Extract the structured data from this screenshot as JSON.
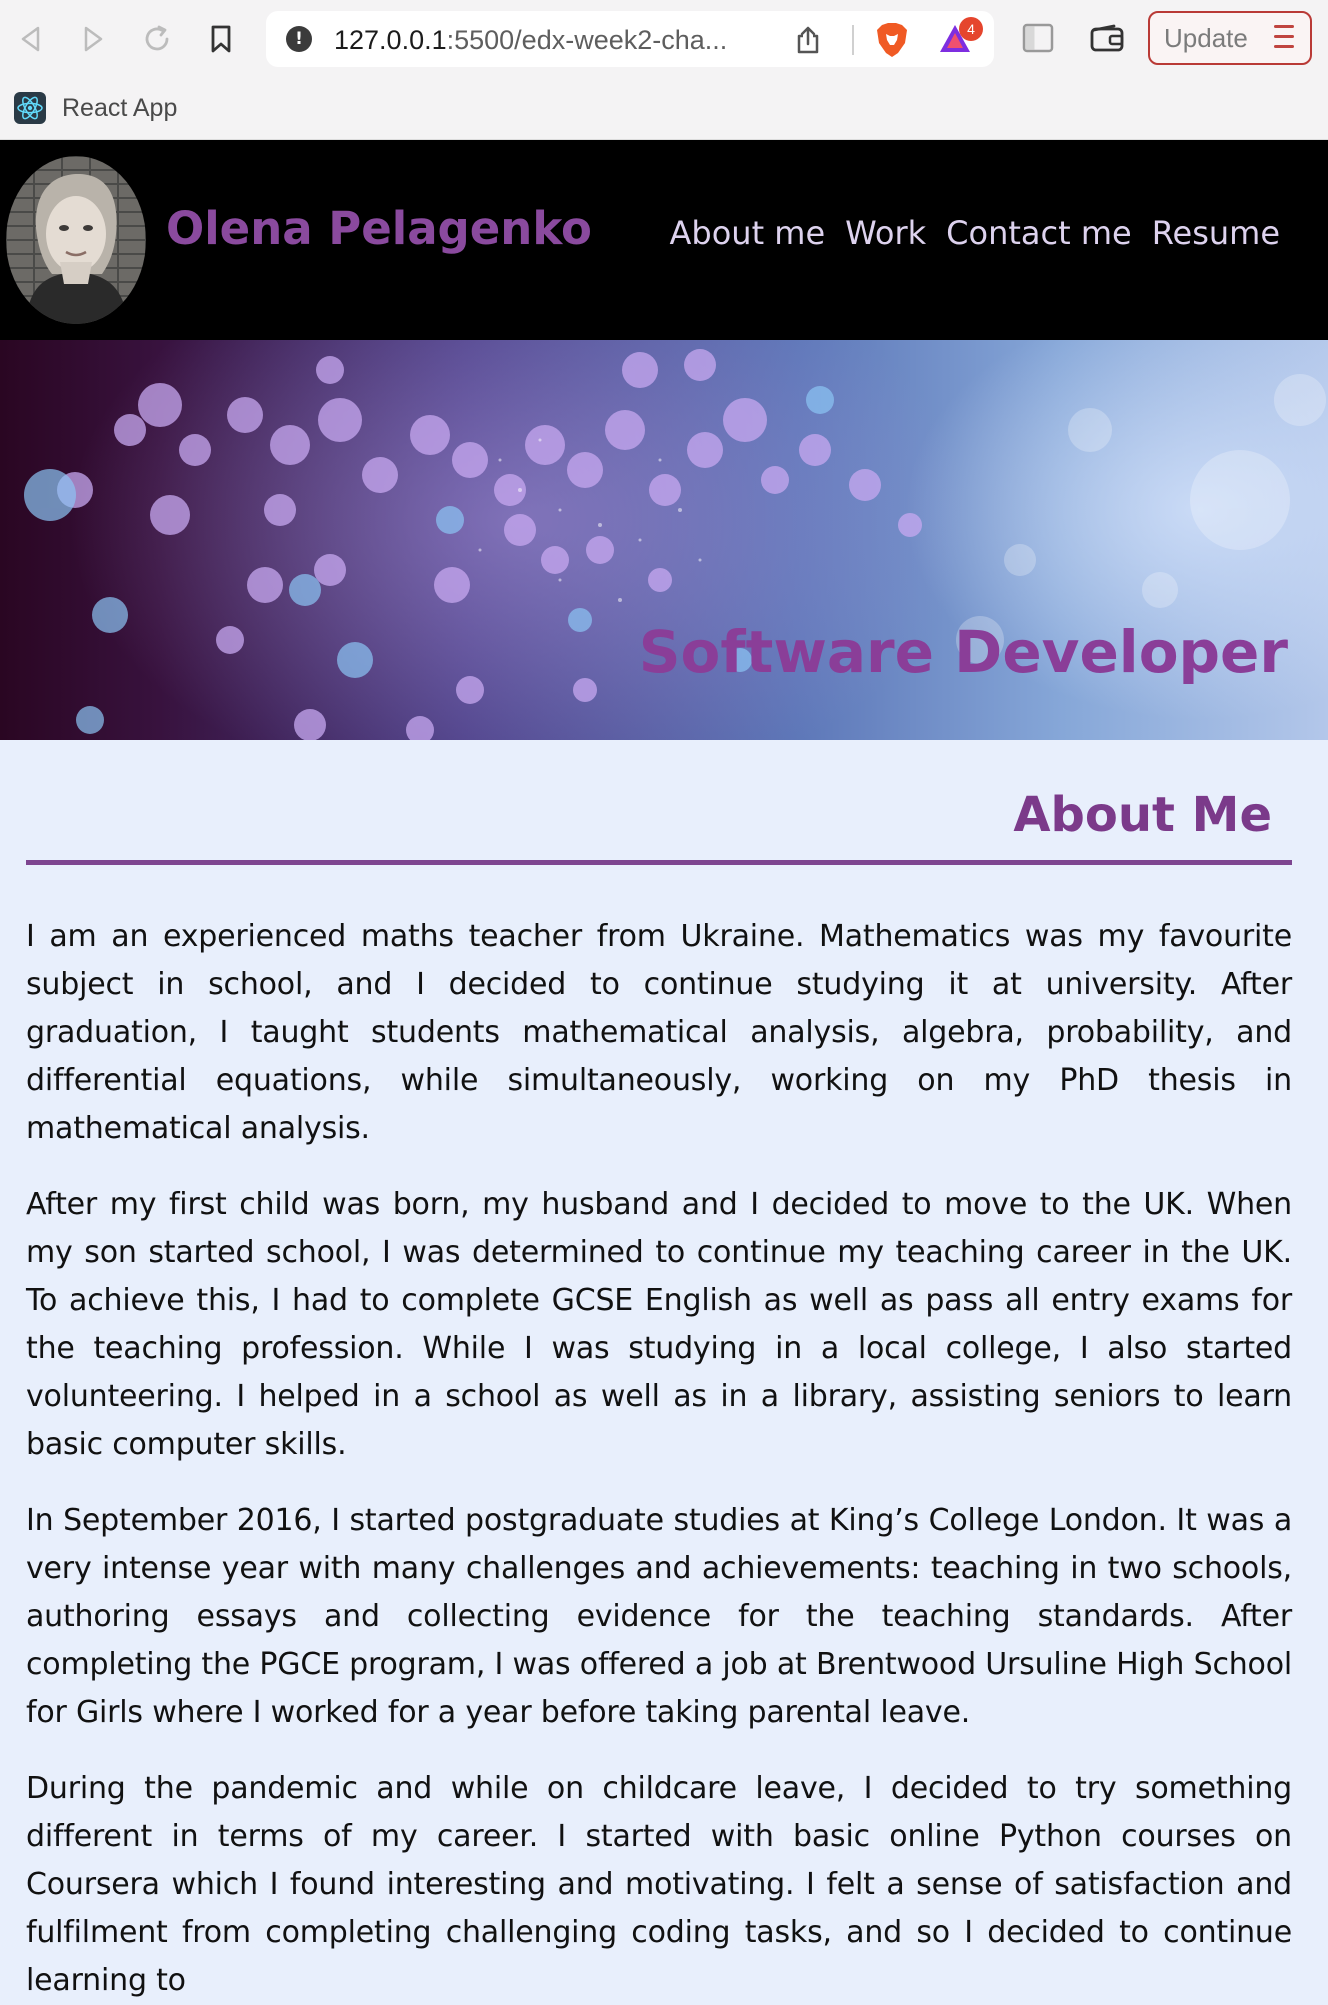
{
  "browser": {
    "url_host": "127.0.0.1",
    "url_rest": ":5500/edx-week2-cha...",
    "rewards_count": "4",
    "update_label": "Update",
    "bookmark_label": "React App"
  },
  "header": {
    "name": "Olena Pelagenko",
    "nav": [
      {
        "label": "About me"
      },
      {
        "label": "Work"
      },
      {
        "label": "Contact me"
      },
      {
        "label": "Resume"
      }
    ]
  },
  "hero": {
    "title": "Software Developer"
  },
  "about": {
    "title": "About Me",
    "paragraphs": [
      "I am an experienced maths teacher from Ukraine. Mathematics was my favourite subject in school, and I decided to continue studying it at university. After graduation, I taught students mathematical analysis, algebra, probability, and differential equations, while simultaneously, working on my PhD thesis in mathematical analysis.",
      "After my first child was born, my husband and I decided to move to the UK. When my son started school, I was determined to continue my teaching career in the UK. To achieve this, I had to complete GCSE English as well as pass all entry exams for the teaching profession. While I was studying in a local college, I also started volunteering. I helped in a school as well as in a library, assisting seniors to learn basic computer skills.",
      "In September 2016, I started postgraduate studies at King’s College London. It was a very intense year with many challenges and achievements: teaching in two schools, authoring essays and collecting evidence for the teaching standards. After completing the PGCE program, I was offered a job at Brentwood Ursuline High School for Girls where I worked for a year before taking parental leave.",
      "During the pandemic and while on childcare leave, I decided to try something different in terms of my career. I started with basic online Python courses on Coursera which I found interesting and motivating. I felt a sense of satisfaction and fulfilment from completing challenging coding tasks, and so I decided to continue learning to"
    ]
  },
  "colors": {
    "accent": "#8a3e98",
    "page_bg": "#e8effc",
    "header_bg": "#000000",
    "nav_link": "#ddd2ee"
  }
}
